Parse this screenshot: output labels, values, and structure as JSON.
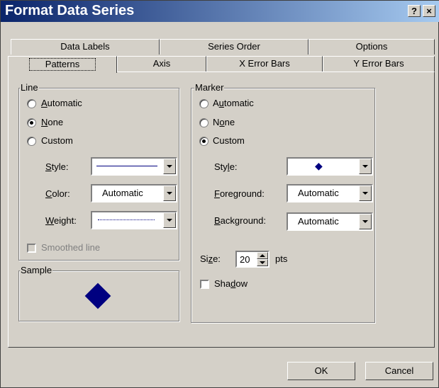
{
  "window": {
    "title": "Format Data Series",
    "help_label": "?",
    "close_label": "×"
  },
  "tabs_row1": [
    "Data Labels",
    "Series Order",
    "Options"
  ],
  "tabs_row2": [
    "Patterns",
    "Axis",
    "X Error Bars",
    "Y Error Bars"
  ],
  "line": {
    "group_label": "Line",
    "automatic": "Automatic",
    "none": "None",
    "custom": "Custom",
    "selected": "none",
    "style_label": "Style:",
    "color_label": "Color:",
    "color_value": "Automatic",
    "weight_label": "Weight:",
    "smoothed_label": "Smoothed line"
  },
  "sample": {
    "group_label": "Sample"
  },
  "marker": {
    "group_label": "Marker",
    "automatic": "Automatic",
    "none": "None",
    "custom": "Custom",
    "selected": "custom",
    "style_label": "Style:",
    "style_symbol": "◆",
    "foreground_label": "Foreground:",
    "foreground_value": "Automatic",
    "background_label": "Background:",
    "background_value": "Automatic",
    "size_label": "Size:",
    "size_value": "20",
    "size_unit": "pts",
    "shadow_label": "Shadow"
  },
  "buttons": {
    "ok": "OK",
    "cancel": "Cancel"
  },
  "colors": {
    "marker": "#000080",
    "line": "#000080"
  }
}
